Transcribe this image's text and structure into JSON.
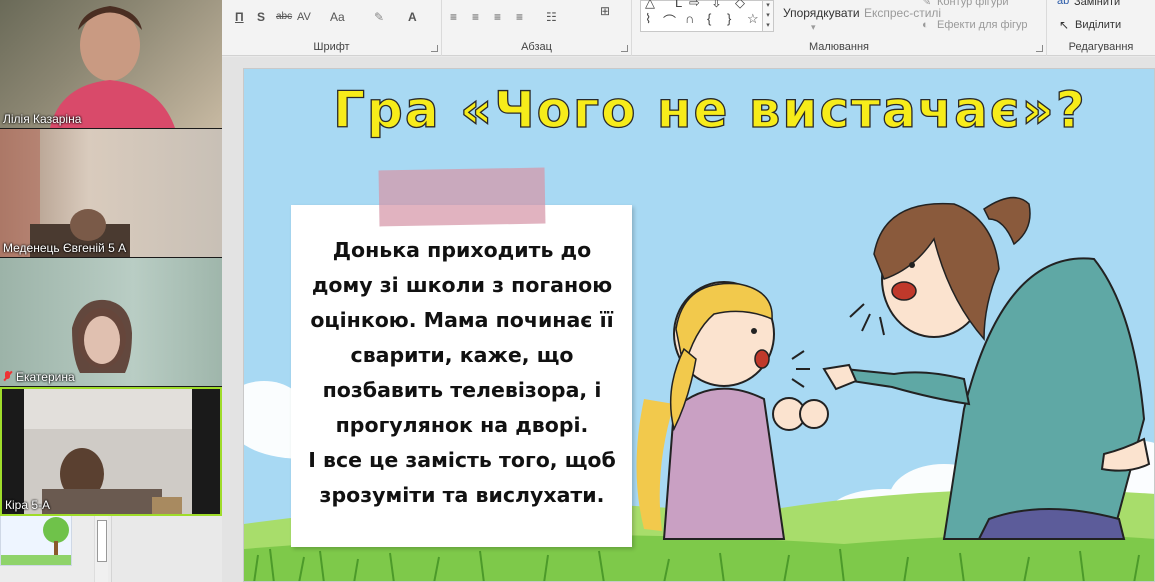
{
  "ribbon": {
    "groups": {
      "font": "Шрифт",
      "paragraph": "Абзац",
      "drawing": "Малювання",
      "editing": "Редагування"
    },
    "font_buttons": [
      "П",
      "S",
      "abc",
      "AV",
      "Aa",
      "A"
    ],
    "arrange_label": "Упорядкувати",
    "quick_styles_label": "Експрес-стилі",
    "shape_outline_label": "Контур фігури",
    "shape_effects_label": "Ефекти для фігур",
    "replace_label": "Замінити",
    "select_label": "Виділити"
  },
  "video": {
    "participants": [
      {
        "name": "Лілія Казаріна",
        "muted": false
      },
      {
        "name": "Меденець Євгеній 5 А",
        "muted": false
      },
      {
        "name": "Екатерина",
        "muted": true
      },
      {
        "name": "Кіра 5-А",
        "muted": false
      }
    ]
  },
  "slide": {
    "title": "Гра «Чого не вистачає»?",
    "note_lines": [
      "Донька приходить до",
      "дому зі школи з поганою",
      "оцінкою. Мама починає її",
      "сварити, каже, що",
      "позбавить телевізора, і",
      "прогулянок на дворі.",
      "І все це замість того, щоб",
      "зрозуміти та вислухати."
    ],
    "colors": {
      "title_fill": "#f7ec1a",
      "sky": "#a8d9f3",
      "grass": "#7ec94a",
      "tape": "#d696a8"
    }
  }
}
